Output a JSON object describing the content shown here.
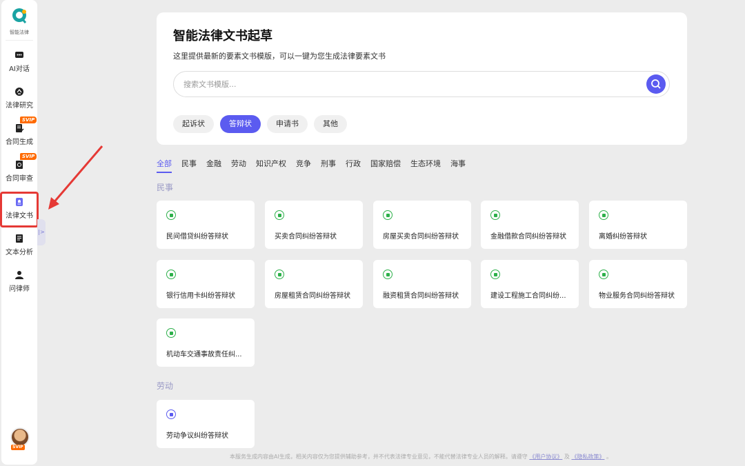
{
  "sidebar": {
    "logo_text": "智能法律",
    "items": [
      {
        "label": "AI对话",
        "icon": "chat-icon",
        "svip": false
      },
      {
        "label": "法律研究",
        "icon": "research-icon",
        "svip": false
      },
      {
        "label": "合同生成",
        "icon": "contract-generate-icon",
        "svip": true
      },
      {
        "label": "合同审查",
        "icon": "contract-review-icon",
        "svip": true
      },
      {
        "label": "法律文书",
        "icon": "legal-document-icon",
        "svip": false
      },
      {
        "label": "文本分析",
        "icon": "text-analysis-icon",
        "svip": false
      },
      {
        "label": "问律师",
        "icon": "lawyer-icon",
        "svip": false
      }
    ],
    "active": "法律文书",
    "svip_badge": "SVIP",
    "avatar_badge": "SVIP",
    "collapse_glyph": "|>"
  },
  "header": {
    "title": "智能法律文书起草",
    "subtitle": "这里提供最新的要素文书模版，可以一键为您生成法律要素文书",
    "search_placeholder": "搜索文书模版...",
    "pills": [
      "起诉状",
      "答辩状",
      "申请书",
      "其他"
    ],
    "active_pill": "答辩状"
  },
  "categories": [
    "全部",
    "民事",
    "金融",
    "劳动",
    "知识产权",
    "竞争",
    "刑事",
    "行政",
    "国家赔偿",
    "生态环境",
    "海事"
  ],
  "active_category": "全部",
  "sections": [
    {
      "title": "民事",
      "items": [
        "民间借贷纠纷答辩状",
        "买卖合同纠纷答辩状",
        "房屋买卖合同纠纷答辩状",
        "金融借款合同纠纷答辩状",
        "离婚纠纷答辩状",
        "银行信用卡纠纷答辩状",
        "房屋租赁合同纠纷答辩状",
        "融资租赁合同纠纷答辩状",
        "建设工程施工合同纠纷...",
        "物业服务合同纠纷答辩状",
        "机动车交通事故责任纠..."
      ]
    },
    {
      "title": "劳动",
      "items": [
        "劳动争议纠纷答辩状"
      ]
    }
  ],
  "footer": {
    "text": "本服务生成内容由AI生成，相关内容仅为您提供辅助参考，并不代表法律专业意见，不能代替法律专业人员的解释。请遵守",
    "link1": "《用户协议》",
    "and": "及",
    "link2": "《隐私政策》",
    "end": "。"
  },
  "colors": {
    "accent": "#5b5bf0",
    "icon_green": "#2db04a",
    "annotation_red": "#e53935"
  }
}
